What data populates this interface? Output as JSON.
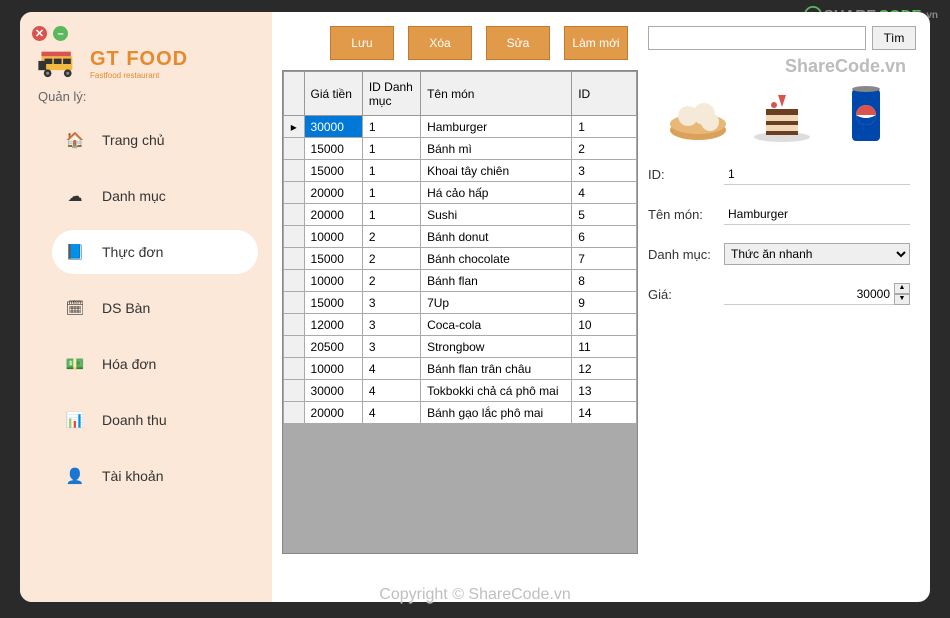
{
  "watermarks": {
    "top_logo": "SHARECODE.vn",
    "right": "ShareCode.vn",
    "bottom": "Copyright © ShareCode.vn"
  },
  "logo": {
    "title": "GT FOOD",
    "subtitle": "Fastfood restaurant"
  },
  "sidebar": {
    "section": "Quản lý:",
    "items": [
      {
        "label": "Trang chủ",
        "icon": "🏠"
      },
      {
        "label": "Danh mục",
        "icon": "☁"
      },
      {
        "label": "Thực đơn",
        "icon": "📘"
      },
      {
        "label": "DS Bàn",
        "icon": "🗓"
      },
      {
        "label": "Hóa đơn",
        "icon": "💵"
      },
      {
        "label": "Doanh thu",
        "icon": "📊"
      },
      {
        "label": "Tài khoản",
        "icon": "👤"
      }
    ]
  },
  "toolbar": {
    "save": "Lưu",
    "delete": "Xóa",
    "edit": "Sửa",
    "refresh": "Làm mới"
  },
  "search": {
    "placeholder": "",
    "value": "",
    "button": "Tìm"
  },
  "grid": {
    "headers": {
      "price": "Giá tiền",
      "cat": "ID Danh mục",
      "name": "Tên món",
      "id": "ID"
    },
    "rows": [
      {
        "price": "30000",
        "cat": "1",
        "name": "Hamburger",
        "id": "1",
        "selected": true
      },
      {
        "price": "15000",
        "cat": "1",
        "name": "Bánh mì",
        "id": "2"
      },
      {
        "price": "15000",
        "cat": "1",
        "name": "Khoai tây chiên",
        "id": "3"
      },
      {
        "price": "20000",
        "cat": "1",
        "name": "Há cảo hấp",
        "id": "4"
      },
      {
        "price": "20000",
        "cat": "1",
        "name": "Sushi",
        "id": "5"
      },
      {
        "price": "10000",
        "cat": "2",
        "name": "Bánh donut",
        "id": "6"
      },
      {
        "price": "15000",
        "cat": "2",
        "name": "Bánh chocolate",
        "id": "7"
      },
      {
        "price": "10000",
        "cat": "2",
        "name": "Bánh flan",
        "id": "8"
      },
      {
        "price": "15000",
        "cat": "3",
        "name": "7Up",
        "id": "9"
      },
      {
        "price": "12000",
        "cat": "3",
        "name": "Coca-cola",
        "id": "10"
      },
      {
        "price": "20500",
        "cat": "3",
        "name": "Strongbow",
        "id": "11"
      },
      {
        "price": "10000",
        "cat": "4",
        "name": "Bánh flan trân châu",
        "id": "12"
      },
      {
        "price": "30000",
        "cat": "4",
        "name": "Tokbokki chả cá phô mai",
        "id": "13"
      },
      {
        "price": "20000",
        "cat": "4",
        "name": "Bánh gạo lắc phô mai",
        "id": "14"
      }
    ]
  },
  "form": {
    "id_label": "ID:",
    "id_value": "1",
    "name_label": "Tên món:",
    "name_value": "Hamburger",
    "cat_label": "Danh mục:",
    "cat_value": "Thức ăn nhanh",
    "price_label": "Giá:",
    "price_value": "30000"
  },
  "thumbs": [
    "dimsum-icon",
    "cake-icon",
    "pepsi-can-icon"
  ]
}
